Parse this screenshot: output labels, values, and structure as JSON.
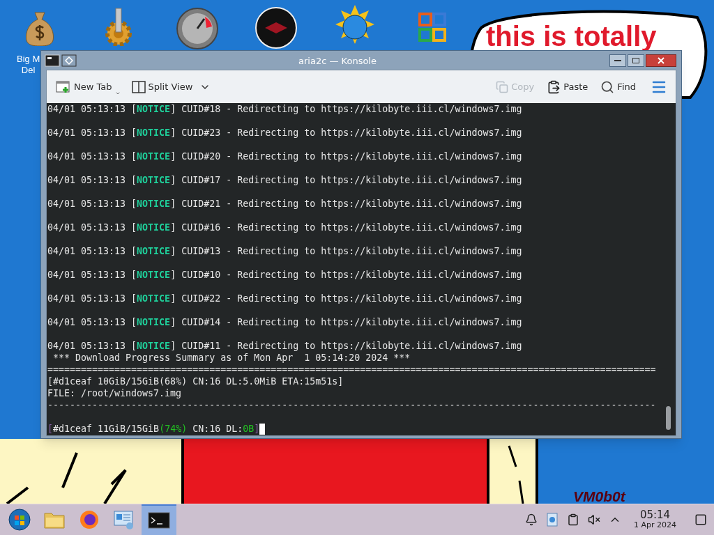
{
  "desktop": {
    "icon_label_lines": [
      "Big M",
      "Del"
    ],
    "bubble_text": "this is totally",
    "signature": "VM0b0t"
  },
  "window": {
    "title": "aria2c — Konsole",
    "toolbar": [
      {
        "kind": "new-tab",
        "label": "New Tab",
        "disabled": false
      },
      {
        "kind": "split-view",
        "label": "Split View",
        "disabled": false
      },
      {
        "kind": "copy",
        "label": "Copy",
        "disabled": true
      },
      {
        "kind": "paste",
        "label": "Paste",
        "disabled": false
      },
      {
        "kind": "find",
        "label": "Find",
        "disabled": false
      }
    ],
    "terminal": [
      {
        "kind": "log",
        "parts": [
          {
            "text": "04/01 05:13:13 [",
            "kind": "plain"
          },
          {
            "text": "NOTICE",
            "kind": "notice"
          },
          {
            "text": "] CUID#18 - Redirecting to https://kilobyte.iii.cl/windows7.img",
            "kind": "plain"
          }
        ]
      },
      {
        "kind": "log",
        "parts": [
          {
            "text": "04/01 05:13:13 [",
            "kind": "plain"
          },
          {
            "text": "NOTICE",
            "kind": "notice"
          },
          {
            "text": "] CUID#23 - Redirecting to https://kilobyte.iii.cl/windows7.img",
            "kind": "plain"
          }
        ]
      },
      {
        "kind": "log",
        "parts": [
          {
            "text": "04/01 05:13:13 [",
            "kind": "plain"
          },
          {
            "text": "NOTICE",
            "kind": "notice"
          },
          {
            "text": "] CUID#20 - Redirecting to https://kilobyte.iii.cl/windows7.img",
            "kind": "plain"
          }
        ]
      },
      {
        "kind": "log",
        "parts": [
          {
            "text": "04/01 05:13:13 [",
            "kind": "plain"
          },
          {
            "text": "NOTICE",
            "kind": "notice"
          },
          {
            "text": "] CUID#17 - Redirecting to https://kilobyte.iii.cl/windows7.img",
            "kind": "plain"
          }
        ]
      },
      {
        "kind": "log",
        "parts": [
          {
            "text": "04/01 05:13:13 [",
            "kind": "plain"
          },
          {
            "text": "NOTICE",
            "kind": "notice"
          },
          {
            "text": "] CUID#21 - Redirecting to https://kilobyte.iii.cl/windows7.img",
            "kind": "plain"
          }
        ]
      },
      {
        "kind": "log",
        "parts": [
          {
            "text": "04/01 05:13:13 [",
            "kind": "plain"
          },
          {
            "text": "NOTICE",
            "kind": "notice"
          },
          {
            "text": "] CUID#16 - Redirecting to https://kilobyte.iii.cl/windows7.img",
            "kind": "plain"
          }
        ]
      },
      {
        "kind": "log",
        "parts": [
          {
            "text": "04/01 05:13:13 [",
            "kind": "plain"
          },
          {
            "text": "NOTICE",
            "kind": "notice"
          },
          {
            "text": "] CUID#13 - Redirecting to https://kilobyte.iii.cl/windows7.img",
            "kind": "plain"
          }
        ]
      },
      {
        "kind": "log",
        "parts": [
          {
            "text": "04/01 05:13:13 [",
            "kind": "plain"
          },
          {
            "text": "NOTICE",
            "kind": "notice"
          },
          {
            "text": "] CUID#10 - Redirecting to https://kilobyte.iii.cl/windows7.img",
            "kind": "plain"
          }
        ]
      },
      {
        "kind": "log",
        "parts": [
          {
            "text": "04/01 05:13:13 [",
            "kind": "plain"
          },
          {
            "text": "NOTICE",
            "kind": "notice"
          },
          {
            "text": "] CUID#22 - Redirecting to https://kilobyte.iii.cl/windows7.img",
            "kind": "plain"
          }
        ]
      },
      {
        "kind": "log",
        "parts": [
          {
            "text": "04/01 05:13:13 [",
            "kind": "plain"
          },
          {
            "text": "NOTICE",
            "kind": "notice"
          },
          {
            "text": "] CUID#14 - Redirecting to https://kilobyte.iii.cl/windows7.img",
            "kind": "plain"
          }
        ]
      },
      {
        "kind": "text",
        "parts": [
          {
            "text": "04/01 05:13:13 [",
            "kind": "plain"
          },
          {
            "text": "NOTICE",
            "kind": "notice"
          },
          {
            "text": "] CUID#11 - Redirecting to https://kilobyte.iii.cl/windows7.img",
            "kind": "plain"
          }
        ]
      },
      {
        "kind": "text",
        "parts": [
          {
            "text": " *** Download Progress Summary as of Mon Apr  1 05:14:20 2024 ***",
            "kind": "plain"
          }
        ]
      },
      {
        "kind": "text",
        "parts": [
          {
            "text": "=============================================================================================================",
            "kind": "plain"
          }
        ]
      },
      {
        "kind": "text",
        "parts": [
          {
            "text": "[#d1ceaf 10GiB/15GiB(68%) CN:16 DL:5.0MiB ETA:15m51s]",
            "kind": "plain"
          }
        ]
      },
      {
        "kind": "text",
        "parts": [
          {
            "text": "FILE: /root/windows7.img",
            "kind": "plain"
          }
        ]
      },
      {
        "kind": "gap",
        "parts": [
          {
            "text": "-------------------------------------------------------------------------------------------------------------",
            "kind": "plain"
          }
        ]
      },
      {
        "kind": "prompt",
        "parts": [
          {
            "text": "[",
            "kind": "dim"
          },
          {
            "text": "#d1ceaf 11GiB/15GiB",
            "kind": "plain"
          },
          {
            "text": "(74%)",
            "kind": "green"
          },
          {
            "text": " CN:16 DL:",
            "kind": "plain"
          },
          {
            "text": "0B",
            "kind": "green"
          },
          {
            "text": "]",
            "kind": "dim"
          }
        ]
      }
    ]
  },
  "taskbar": {
    "apps": [
      {
        "kind": "start",
        "selected": false
      },
      {
        "kind": "files",
        "selected": false
      },
      {
        "kind": "browser",
        "selected": false
      },
      {
        "kind": "settings",
        "selected": false
      },
      {
        "kind": "terminal",
        "selected": true
      }
    ],
    "clock": {
      "time": "05:14",
      "date": "1 Apr 2024"
    }
  }
}
